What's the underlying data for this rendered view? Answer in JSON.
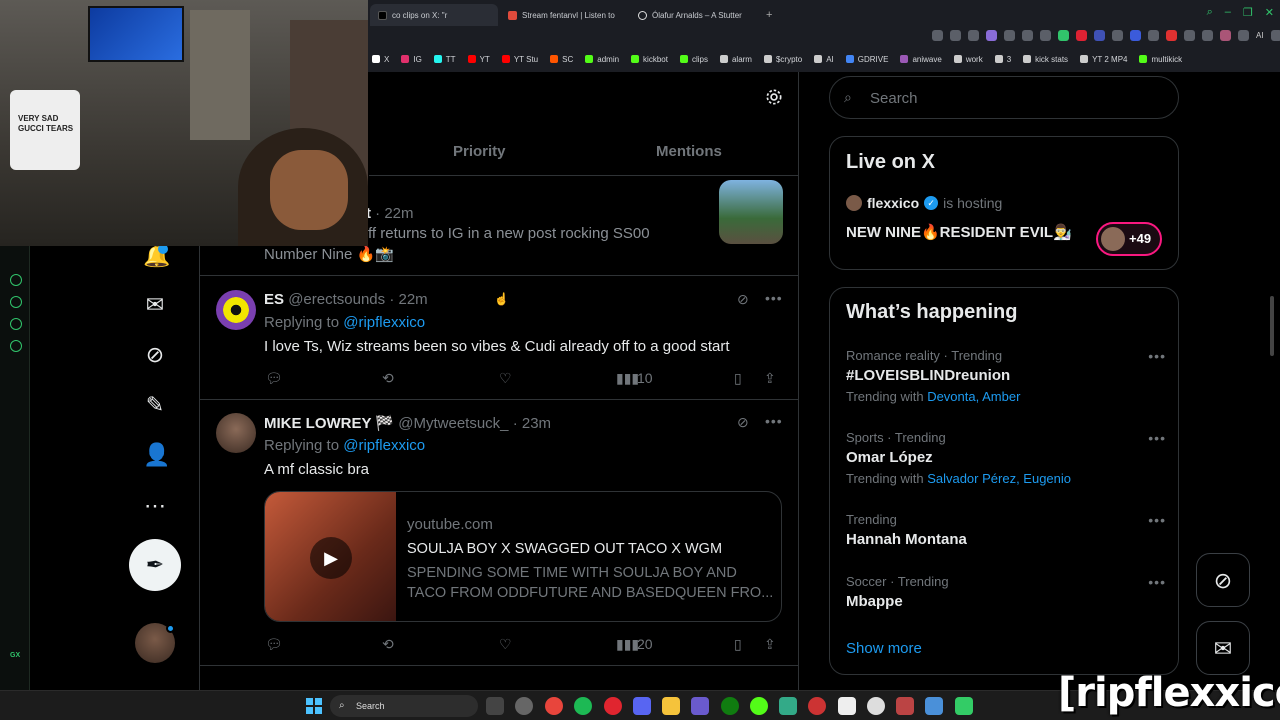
{
  "browser": {
    "tabs": [
      {
        "label": "co clips on X: \"r"
      },
      {
        "label": "Stream fentanvl | Listen to"
      },
      {
        "label": "Ólafur Arnalds – A Stutter"
      }
    ],
    "new_tab": "+",
    "window_controls": [
      "–",
      "❐",
      "✕"
    ],
    "bookmarks": [
      {
        "label": "X",
        "color": "#ffffff"
      },
      {
        "label": "IG",
        "color": "#e1306c"
      },
      {
        "label": "TT",
        "color": "#25f4ee"
      },
      {
        "label": "YT",
        "color": "#ff0000"
      },
      {
        "label": "YT Stu",
        "color": "#ff0000"
      },
      {
        "label": "SC",
        "color": "#ff5500"
      },
      {
        "label": "admin",
        "color": "#53fc18"
      },
      {
        "label": "kickbot",
        "color": "#53fc18"
      },
      {
        "label": "clips",
        "color": "#53fc18"
      },
      {
        "label": "alarm",
        "color": "#cccccc"
      },
      {
        "label": "$crypto",
        "color": "#cccccc"
      },
      {
        "label": "AI",
        "color": "#cccccc"
      },
      {
        "label": "GDRIVE",
        "color": "#4285f4"
      },
      {
        "label": "aniwave",
        "color": "#9b59b6"
      },
      {
        "label": "work",
        "color": "#cccccc"
      },
      {
        "label": "3",
        "color": "#cccccc"
      },
      {
        "label": "kick stats",
        "color": "#cccccc"
      },
      {
        "label": "YT 2 MP4",
        "color": "#cccccc"
      },
      {
        "label": "multikick",
        "color": "#53fc18"
      }
    ],
    "extensions_label": "AI"
  },
  "webcam": {
    "shirt_text": "VERY SAD GUCCI TEARS"
  },
  "nav": {
    "icons": [
      "notifications-icon",
      "messages-icon",
      "grok-icon",
      "lists-icon",
      "profile-icon",
      "more-icon"
    ]
  },
  "tabs": {
    "priority": "Priority",
    "mentions": "Mentions"
  },
  "tweets": [
    {
      "name_partial": "t",
      "time": "· 22m",
      "text_line1": "ff returns to IG in a new post rocking SS00",
      "text_line2": "Number Nine 🔥📸"
    },
    {
      "name": "ES",
      "handle": "@erectsounds",
      "time": "· 22m",
      "replying_prefix": "Replying to",
      "replying_to": "@ripflexxico",
      "text": "I love Ts, Wiz streams been so vibes & Cudi already off to a good start",
      "views": "10"
    },
    {
      "name": "MIKE LOWREY 🏁",
      "handle": "@Mytweetsuck_",
      "time": "· 23m",
      "replying_prefix": "Replying to",
      "replying_to": "@ripflexxico",
      "text": "A mf classic bra",
      "views": "20",
      "card": {
        "domain": "youtube.com",
        "title": "SOULJA BOY X SWAGGED OUT TACO X WGM",
        "description": "SPENDING SOME TIME WITH SOULJA BOY AND TACO FROM ODDFUTURE AND BASEDQUEEN FRO..."
      }
    }
  ],
  "search": {
    "placeholder": "Search"
  },
  "live": {
    "title": "Live on X",
    "host": "flexxico",
    "host_suffix": "is hosting",
    "space_title": "NEW NINE🔥RESIDENT EVIL👨‍🔬",
    "listener_count": "+49"
  },
  "happening": {
    "title": "What’s happening",
    "trends": [
      {
        "meta": "Romance reality · Trending",
        "name": "#LOVEISBLINDreunion",
        "with_prefix": "Trending with",
        "with": "Devonta, Amber"
      },
      {
        "meta": "Sports · Trending",
        "name": "Omar López",
        "with_prefix": "Trending with",
        "with": "Salvador Pérez, Eugenio"
      },
      {
        "meta": "Trending",
        "name": "Hannah Montana"
      },
      {
        "meta": "Soccer · Trending",
        "name": "Mbappe"
      }
    ],
    "show_more": "Show more"
  },
  "watermark": "[ripflexxico]",
  "taskbar": {
    "search_label": "Search"
  },
  "colors": {
    "accent": "#1d9bf0",
    "live": "#f91880",
    "gx": "#31c46b"
  }
}
